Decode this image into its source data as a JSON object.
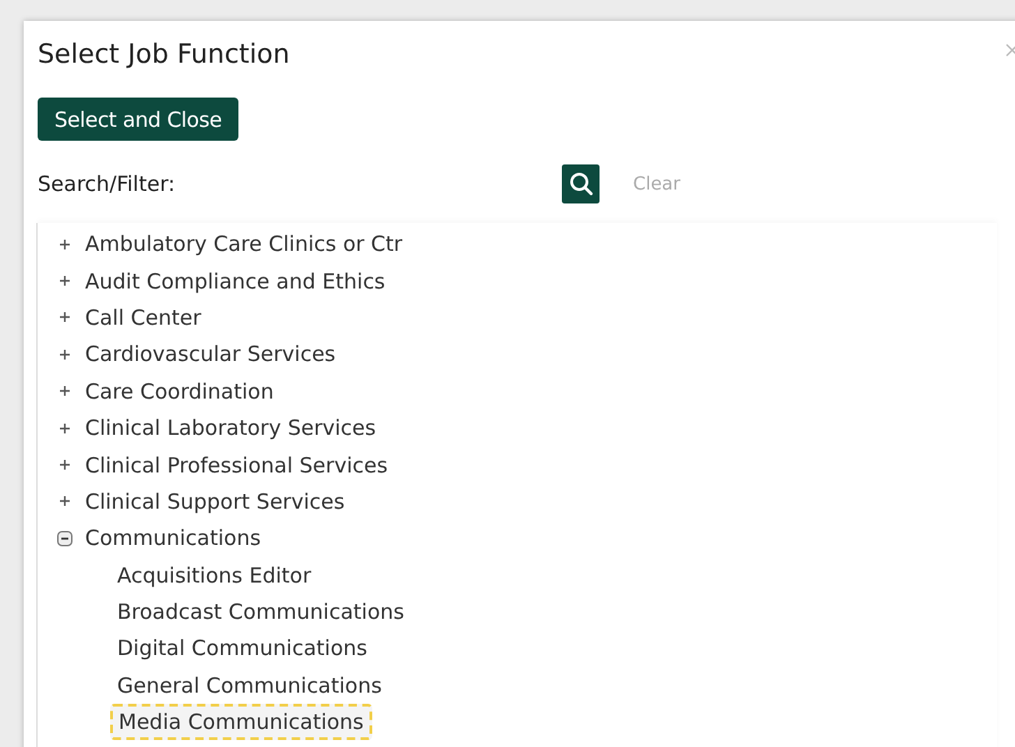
{
  "dialog": {
    "title": "Select Job Function",
    "primary_button": "Select and Close",
    "search": {
      "label": "Search/Filter:",
      "clear": "Clear"
    }
  },
  "tree": [
    {
      "label": "Ambulatory Care Clinics or Ctr",
      "expanded": false,
      "selected": false
    },
    {
      "label": "Audit Compliance and Ethics",
      "expanded": false,
      "selected": false
    },
    {
      "label": "Call Center",
      "expanded": false,
      "selected": false
    },
    {
      "label": "Cardiovascular Services",
      "expanded": false,
      "selected": false
    },
    {
      "label": "Care Coordination",
      "expanded": false,
      "selected": false
    },
    {
      "label": "Clinical Laboratory Services",
      "expanded": false,
      "selected": false
    },
    {
      "label": "Clinical Professional Services",
      "expanded": false,
      "selected": false
    },
    {
      "label": "Clinical Support Services",
      "expanded": false,
      "selected": false
    },
    {
      "label": "Communications",
      "expanded": true,
      "selected": false,
      "children": [
        {
          "label": "Acquisitions Editor",
          "selected": false
        },
        {
          "label": "Broadcast Communications",
          "selected": false
        },
        {
          "label": "Digital Communications",
          "selected": false
        },
        {
          "label": "General Communications",
          "selected": false
        },
        {
          "label": "Media Communications",
          "selected": true
        }
      ]
    }
  ]
}
